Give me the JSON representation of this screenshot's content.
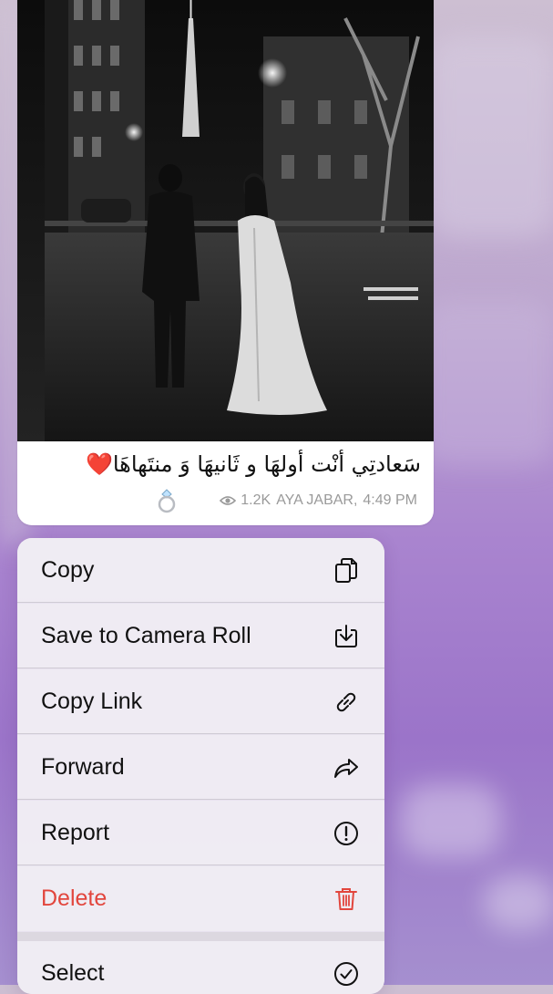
{
  "message": {
    "caption": "سَعادتِي أنْت أولهَا و ثَانيهَا وَ منتَهاهَا",
    "caption_emoji": "❤️",
    "views": "1.2K",
    "author": "AYA JABAR,",
    "time": "4:49 PM",
    "reaction_icon": "ring-icon",
    "photo_icon": "couple-walking-photo"
  },
  "context_menu": {
    "items": [
      {
        "label": "Copy",
        "icon": "copy-icon"
      },
      {
        "label": "Save to Camera Roll",
        "icon": "save-download-icon"
      },
      {
        "label": "Copy Link",
        "icon": "link-icon"
      },
      {
        "label": "Forward",
        "icon": "forward-arrow-icon"
      },
      {
        "label": "Report",
        "icon": "exclamation-circle-icon"
      },
      {
        "label": "Delete",
        "icon": "trash-icon",
        "color": "#e2463d"
      },
      {
        "label": "Select",
        "icon": "checkmark-circle-icon"
      }
    ]
  },
  "colors": {
    "danger": "#e2463d",
    "background_top": "#cdbfd2",
    "background_mid": "#a984cf",
    "bubble": "#ffffff",
    "meta_text": "#9a9a9a"
  }
}
